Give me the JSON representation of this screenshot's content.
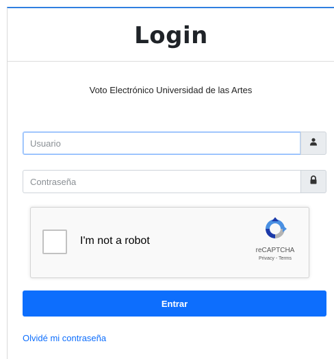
{
  "login": {
    "title": "Login",
    "subtitle": "Voto Electrónico Universidad de las Artes",
    "username": {
      "placeholder": "Usuario",
      "value": "",
      "icon": "user-icon"
    },
    "password": {
      "placeholder": "Contraseña",
      "value": "",
      "icon": "lock-icon"
    },
    "submit_label": "Entrar",
    "forgot_link": "Olvidé mi contraseña"
  },
  "recaptcha": {
    "label": "I'm not a robot",
    "brand": "reCAPTCHA",
    "links": "Privacy - Terms",
    "checked": false
  },
  "colors": {
    "accent": "#0d6efd",
    "header_border": "#2f7fe0",
    "addon_bg": "#e9ecef",
    "recaptcha_blue": "#4a90e2",
    "recaptcha_gray": "#b4b4b4",
    "recaptcha_dark": "#1c3aa9"
  }
}
